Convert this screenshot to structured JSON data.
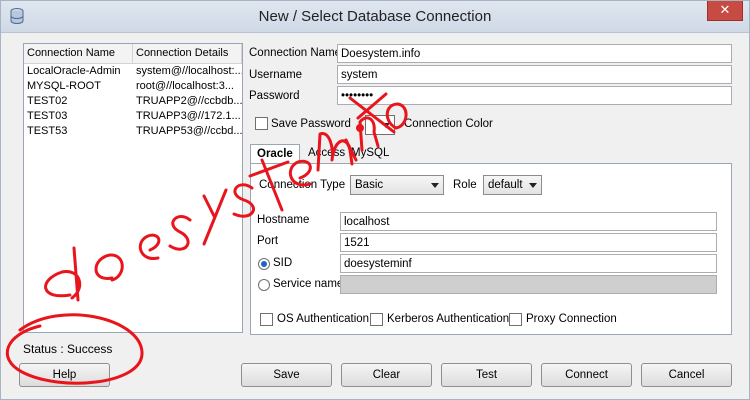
{
  "window": {
    "title": "New / Select Database Connection",
    "close_glyph": "✕",
    "icon": "database-icon"
  },
  "connections": {
    "headers": [
      "Connection Name",
      "Connection Details"
    ],
    "rows": [
      [
        "LocalOracle-Admin",
        "system@//localhost:..."
      ],
      [
        "MYSQL-ROOT",
        "root@//localhost:3..."
      ],
      [
        "TEST02",
        "TRUAPP2@//ccbdb..."
      ],
      [
        "TEST03",
        "TRUAPP3@//172.1..."
      ],
      [
        "TEST53",
        "TRUAPP53@//ccbd..."
      ]
    ]
  },
  "status": {
    "text": "Status : Success"
  },
  "form": {
    "connection_name_label": "Connection Name",
    "connection_name_value": "Doesystem.info",
    "username_label": "Username",
    "username_value": "system",
    "password_label": "Password",
    "password_value": "••••••••",
    "save_password_label": "Save Password",
    "connection_color_label": "Connection Color"
  },
  "tabs": [
    "Oracle",
    "Access",
    "MySQL"
  ],
  "oracle": {
    "connection_type_label": "Connection Type",
    "connection_type_value": "Basic",
    "role_label": "Role",
    "role_value": "default",
    "hostname_label": "Hostname",
    "hostname_value": "localhost",
    "port_label": "Port",
    "port_value": "1521",
    "sid_label": "SID",
    "sid_value": "doesysteminf",
    "service_name_label": "Service name",
    "os_auth_label": "OS Authentication",
    "kerberos_auth_label": "Kerberos Authentication",
    "proxy_label": "Proxy Connection"
  },
  "buttons": {
    "help": "Help",
    "save": "Save",
    "clear": "Clear",
    "test": "Test",
    "connect": "Connect",
    "cancel": "Cancel"
  },
  "annotation": {
    "handwritten_text": "doesystem.info",
    "ink_color": "#e8151d"
  }
}
